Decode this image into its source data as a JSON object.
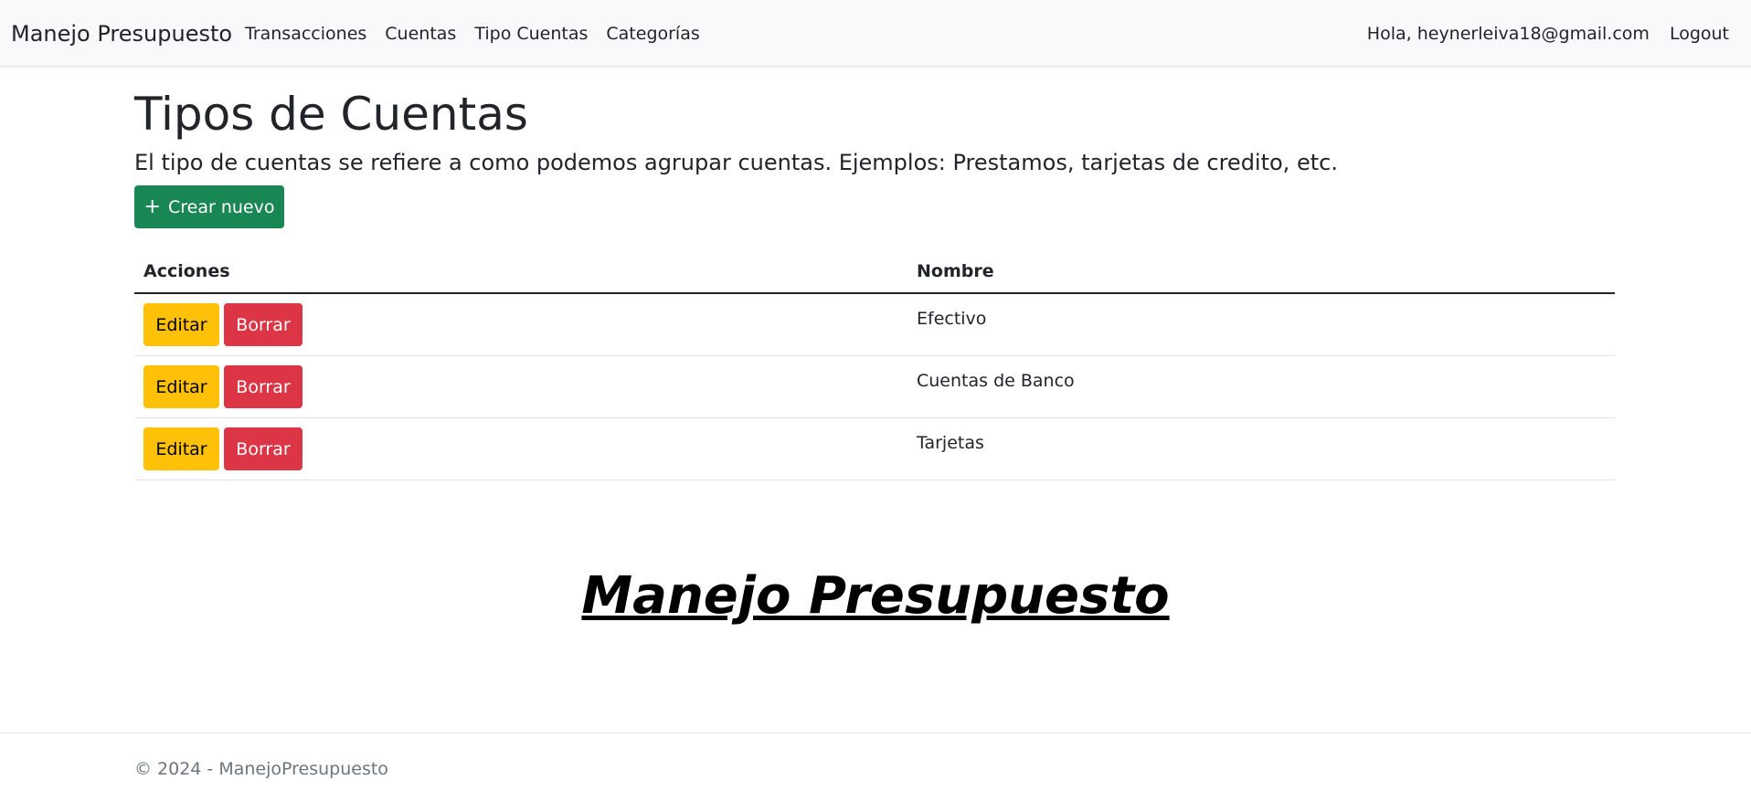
{
  "navbar": {
    "brand": "Manejo Presupuesto",
    "links": [
      "Transacciones",
      "Cuentas",
      "Tipo Cuentas",
      "Categorías"
    ],
    "greeting": "Hola, heynerleiva18@gmail.com",
    "logout": "Logout"
  },
  "page": {
    "title": "Tipos de Cuentas",
    "description": "El tipo de cuentas se refiere a como podemos agrupar cuentas. Ejemplos: Prestamos, tarjetas de credito, etc.",
    "create_button": "Crear nuevo",
    "create_icon": "plus-icon"
  },
  "table": {
    "headers": [
      "Acciones",
      "Nombre"
    ],
    "rows": [
      {
        "name": "Efectivo",
        "edit": "Editar",
        "delete": "Borrar"
      },
      {
        "name": "Cuentas de Banco",
        "edit": "Editar",
        "delete": "Borrar"
      },
      {
        "name": "Tarjetas",
        "edit": "Editar",
        "delete": "Borrar"
      }
    ]
  },
  "banner": "Manejo Presupuesto",
  "footer": "© 2024 - ManejoPresupuesto",
  "colors": {
    "success": "#198754",
    "warning": "#ffc107",
    "danger": "#dc3545",
    "navbar_bg": "#f8f9fa"
  }
}
